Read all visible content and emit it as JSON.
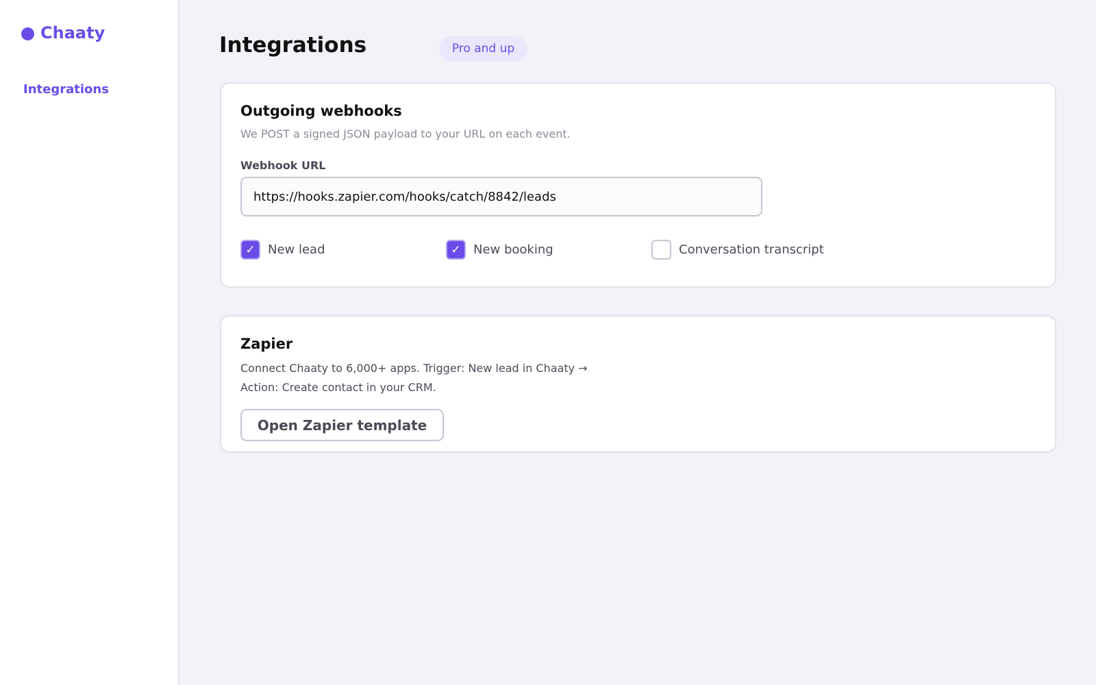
{
  "brand": {
    "name": "Chaaty",
    "accent_color": "#6a4de8"
  },
  "sidebar": {
    "items": [
      {
        "label": "Integrations",
        "active": true
      }
    ]
  },
  "header": {
    "title": "Integrations",
    "badge": "Pro and up"
  },
  "webhooks": {
    "title": "Outgoing webhooks",
    "description": "We POST a signed JSON payload to your URL on each event.",
    "url_label": "Webhook URL",
    "url_value": "https://hooks.zapier.com/hooks/catch/8842/leads",
    "events": [
      {
        "label": "New lead",
        "checked": true
      },
      {
        "label": "New booking",
        "checked": true
      },
      {
        "label": "Conversation transcript",
        "checked": false
      }
    ],
    "check_glyph": "✓"
  },
  "zapier": {
    "title": "Zapier",
    "description": "Connect Chaaty to 6,000+ apps. Trigger: New lead in Chaaty → Action: Create contact in your CRM.",
    "button_label": "Open Zapier template"
  }
}
